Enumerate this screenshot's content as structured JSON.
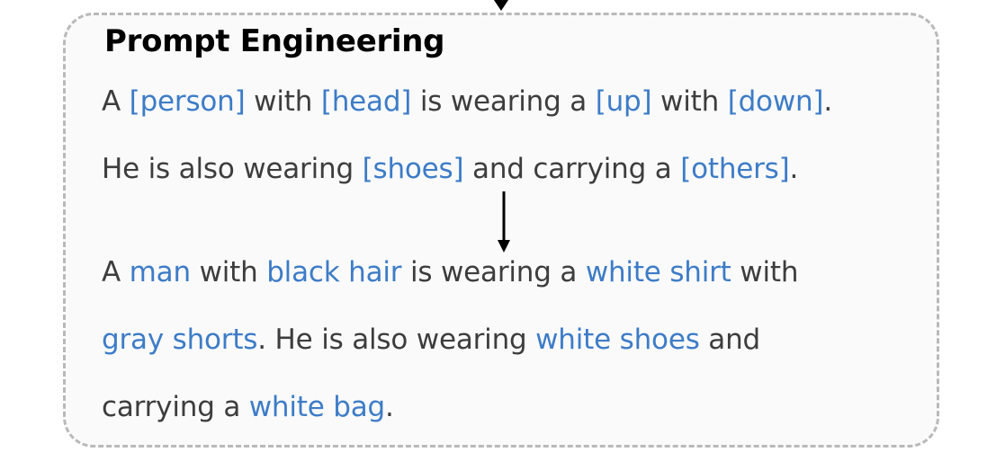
{
  "title": "Prompt Engineering",
  "template": {
    "line1": [
      {
        "text": "A ",
        "kind": "plain"
      },
      {
        "text": "[person]",
        "kind": "key"
      },
      {
        "text": " with ",
        "kind": "plain"
      },
      {
        "text": "[head]",
        "kind": "key"
      },
      {
        "text": " is wearing a ",
        "kind": "plain"
      },
      {
        "text": "[up]",
        "kind": "key"
      },
      {
        "text": " with ",
        "kind": "plain"
      },
      {
        "text": "[down]",
        "kind": "key"
      },
      {
        "text": ".",
        "kind": "plain"
      }
    ],
    "line2": [
      {
        "text": "He is also wearing ",
        "kind": "plain"
      },
      {
        "text": "[shoes]",
        "kind": "key"
      },
      {
        "text": " and carrying a ",
        "kind": "plain"
      },
      {
        "text": "[others]",
        "kind": "key"
      },
      {
        "text": ".",
        "kind": "plain"
      }
    ]
  },
  "example": {
    "line1": [
      {
        "text": "A ",
        "kind": "plain"
      },
      {
        "text": "man",
        "kind": "key"
      },
      {
        "text": " with ",
        "kind": "plain"
      },
      {
        "text": "black hair",
        "kind": "key"
      },
      {
        "text": " is wearing a ",
        "kind": "plain"
      },
      {
        "text": "white shirt",
        "kind": "key"
      },
      {
        "text": " with",
        "kind": "plain"
      }
    ],
    "line2": [
      {
        "text": "gray shorts",
        "kind": "key"
      },
      {
        "text": ". He is also wearing ",
        "kind": "plain"
      },
      {
        "text": "white shoes",
        "kind": "key"
      },
      {
        "text": " and",
        "kind": "plain"
      }
    ],
    "line3": [
      {
        "text": "carrying a ",
        "kind": "plain"
      },
      {
        "text": "white bag",
        "kind": "key"
      },
      {
        "text": ".",
        "kind": "plain"
      }
    ]
  },
  "colors": {
    "plain_text": "#3d3d3d",
    "keyword_text": "#3d7cc7",
    "panel_border": "#b9b9b9",
    "panel_fill": "#fafafa",
    "arrow": "#000000"
  }
}
